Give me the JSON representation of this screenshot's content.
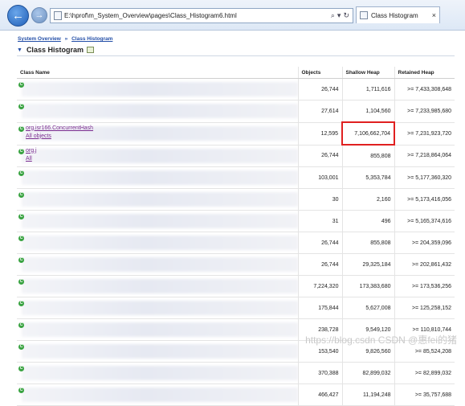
{
  "browser": {
    "address": "E:\\hprof\\m_System_Overview\\pages\\Class_Histogram6.html",
    "tab_title": "Class Histogram",
    "tab_close": "×",
    "search_glyph": "⌕",
    "dropdown_glyph": "▾",
    "refresh_glyph": "↻",
    "back_glyph": "←",
    "forward_glyph": "→"
  },
  "breadcrumb": {
    "items": [
      "System Overview",
      "Class Histogram"
    ],
    "separator": "»"
  },
  "page": {
    "title": "Class Histogram",
    "collapse_glyph": "▼"
  },
  "table": {
    "headers": {
      "class_name": "Class Name",
      "objects": "Objects",
      "shallow_heap": "Shallow Heap",
      "retained_heap": "Retained Heap"
    },
    "rows": [
      {
        "class_name": "",
        "sub": "",
        "objects": "26,744",
        "shallow": "1,711,616",
        "retained": ">= 7,433,308,648"
      },
      {
        "class_name": "",
        "sub": "",
        "objects": "27,614",
        "shallow": "1,104,560",
        "retained": ">= 7,233,985,680"
      },
      {
        "class_name": "org.isr166.ConcurrentHash",
        "sub": "All objects",
        "objects": "12,595",
        "shallow": "7,106,662,704",
        "retained": ">= 7,231,923,720",
        "highlight": true
      },
      {
        "class_name": "org.j",
        "sub": "All",
        "objects": "26,744",
        "shallow": "855,808",
        "retained": ">= 7,218,864,064"
      },
      {
        "class_name": "",
        "sub": "",
        "objects": "103,001",
        "shallow": "5,353,784",
        "retained": ">= 5,177,360,320"
      },
      {
        "class_name": "",
        "sub": "",
        "objects": "30",
        "shallow": "2,160",
        "retained": ">= 5,173,416,056"
      },
      {
        "class_name": "",
        "sub": "",
        "objects": "31",
        "shallow": "496",
        "retained": ">= 5,165,374,616"
      },
      {
        "class_name": "",
        "sub": "",
        "objects": "26,744",
        "shallow": "855,808",
        "retained": ">= 204,359,096"
      },
      {
        "class_name": "",
        "sub": "",
        "objects": "26,744",
        "shallow": "29,325,184",
        "retained": ">= 202,861,432"
      },
      {
        "class_name": "",
        "sub": "",
        "objects": "7,224,320",
        "shallow": "173,383,680",
        "retained": ">= 173,536,256"
      },
      {
        "class_name": "",
        "sub": "",
        "objects": "175,844",
        "shallow": "5,627,008",
        "retained": ">= 125,258,152"
      },
      {
        "class_name": "",
        "sub": "",
        "objects": "238,728",
        "shallow": "9,549,120",
        "retained": ">= 110,810,744"
      },
      {
        "class_name": "",
        "sub": "",
        "objects": "153,540",
        "shallow": "9,826,560",
        "retained": ">= 85,524,208"
      },
      {
        "class_name": "",
        "sub": "",
        "objects": "370,388",
        "shallow": "82,899,032",
        "retained": ">= 82,899,032"
      },
      {
        "class_name": "",
        "sub": "",
        "objects": "466,427",
        "shallow": "11,194,248",
        "retained": ">= 35,757,688"
      }
    ]
  },
  "watermark": "https://blog.csdn CSDN @惠fei的猪"
}
